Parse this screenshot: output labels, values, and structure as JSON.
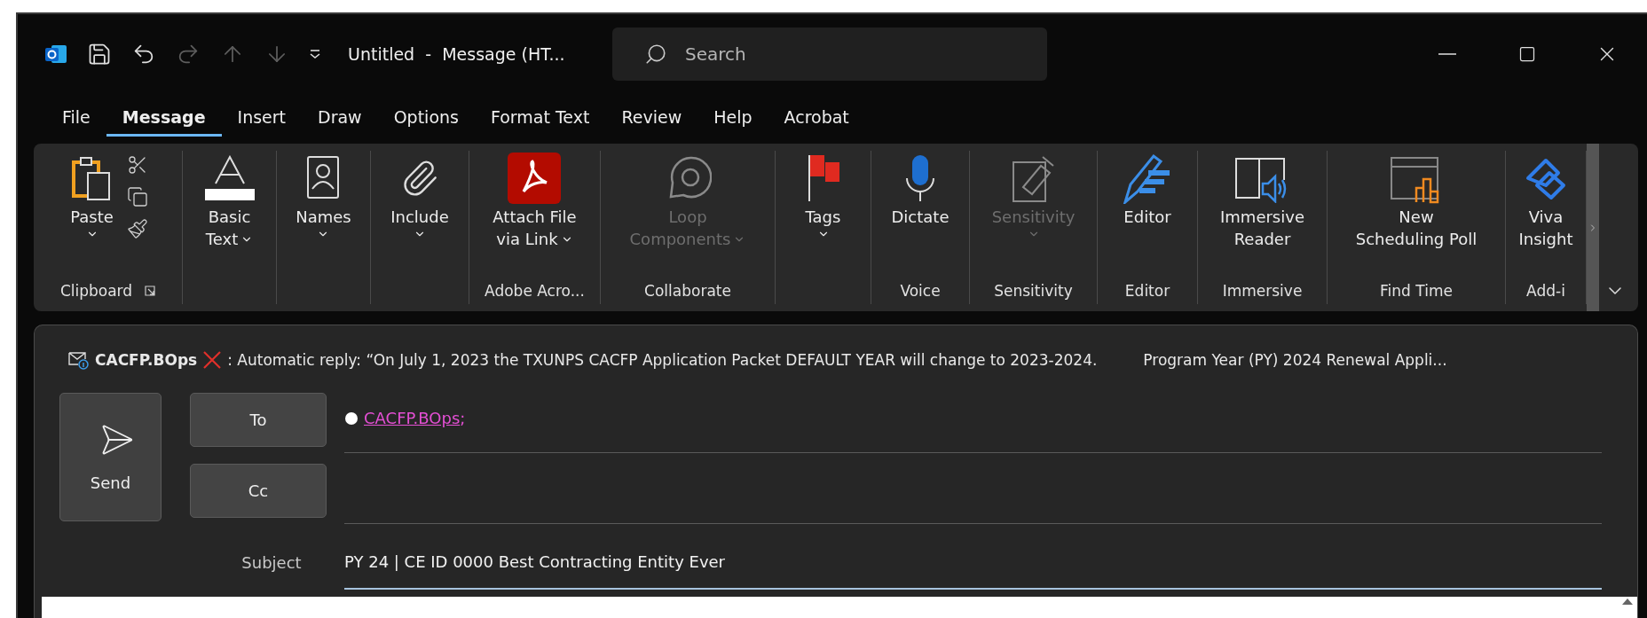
{
  "window": {
    "title": "Untitled  -  Message (HT...",
    "search": {
      "placeholder": "Search"
    }
  },
  "quick_access": [
    {
      "disabled": false
    },
    {
      "disabled": false
    },
    {
      "disabled": true
    },
    {
      "disabled": true
    },
    {
      "disabled": true
    }
  ],
  "tabs": [
    {
      "label": "File",
      "selected": false
    },
    {
      "label": "Message",
      "selected": true
    },
    {
      "label": "Insert",
      "selected": false
    },
    {
      "label": "Draw",
      "selected": false
    },
    {
      "label": "Options",
      "selected": false
    },
    {
      "label": "Format Text",
      "selected": false
    },
    {
      "label": "Review",
      "selected": false
    },
    {
      "label": "Help",
      "selected": false
    },
    {
      "label": "Acrobat",
      "selected": false
    }
  ],
  "ribbon": {
    "groups": [
      {
        "label": "Clipboard",
        "buttons": [
          {
            "lines": [
              "Paste"
            ],
            "dropdown": true,
            "disabled": false
          }
        ]
      },
      {
        "buttons": [
          {
            "lines": [
              "Basic",
              "Text"
            ],
            "dropdown": true,
            "disabled": false
          }
        ]
      },
      {
        "buttons": [
          {
            "lines": [
              "Names"
            ],
            "dropdown": true,
            "disabled": false
          }
        ]
      },
      {
        "buttons": [
          {
            "lines": [
              "Include"
            ],
            "dropdown": true,
            "disabled": false
          }
        ]
      },
      {
        "label": "Adobe Acro...",
        "buttons": [
          {
            "lines": [
              "Attach File",
              "via Link"
            ],
            "dropdown": true,
            "disabled": false
          }
        ]
      },
      {
        "label": "Collaborate",
        "buttons": [
          {
            "lines": [
              "Loop",
              "Components"
            ],
            "dropdown": true,
            "disabled": true
          }
        ]
      },
      {
        "buttons": [
          {
            "lines": [
              "Tags"
            ],
            "dropdown": true,
            "disabled": false
          }
        ]
      },
      {
        "label": "Voice",
        "buttons": [
          {
            "lines": [
              "Dictate"
            ],
            "dropdown": false,
            "disabled": false
          }
        ]
      },
      {
        "label": "Sensitivity",
        "buttons": [
          {
            "lines": [
              "Sensitivity"
            ],
            "dropdown": true,
            "disabled": true
          }
        ]
      },
      {
        "label": "Editor",
        "buttons": [
          {
            "lines": [
              "Editor"
            ],
            "dropdown": false,
            "disabled": false
          }
        ]
      },
      {
        "label": "Immersive",
        "buttons": [
          {
            "lines": [
              "Immersive",
              "Reader"
            ],
            "dropdown": false,
            "disabled": false
          }
        ]
      },
      {
        "label": "Find Time",
        "buttons": [
          {
            "lines": [
              "New",
              "Scheduling Poll"
            ],
            "dropdown": false,
            "disabled": false
          }
        ]
      },
      {
        "label": "Add-i",
        "buttons": [
          {
            "lines": [
              "Viva",
              "Insight"
            ],
            "dropdown": false,
            "disabled": false
          }
        ]
      }
    ]
  },
  "message": {
    "info_bar": {
      "sender": "CACFP.BOps",
      "text": ": Automatic reply:  “On July 1, 2023 the TXUNPS CACFP Application Packet DEFAULT YEAR will change to 2023-2024.",
      "extra": "Program Year (PY) 2024 Renewal Appli..."
    },
    "send": "Send",
    "to": {
      "label": "To",
      "recipients": [
        {
          "name": "CACFP.BOps",
          "separator": ";"
        }
      ]
    },
    "cc": {
      "label": "Cc"
    },
    "subject": {
      "label": "Subject",
      "value": "PY 24 | CE ID 0000 Best Contracting Entity Ever"
    }
  }
}
